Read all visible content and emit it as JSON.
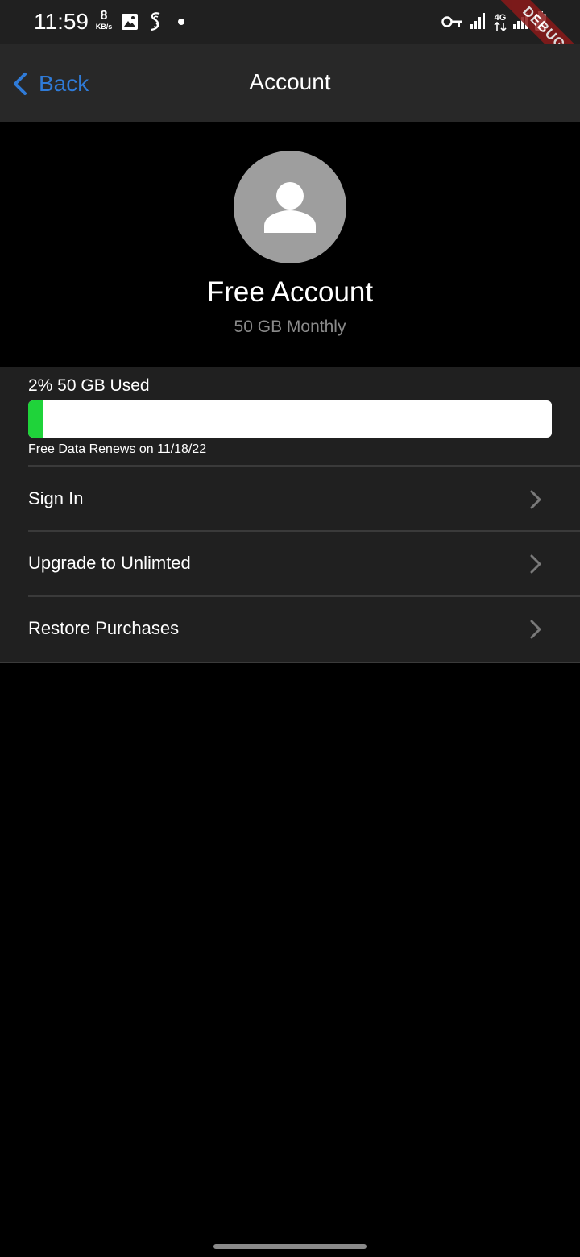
{
  "status_bar": {
    "time": "11:59",
    "net_speed_value": "8",
    "net_speed_unit": "KB/s",
    "network_type": "4G",
    "debug_banner": "DEBUG"
  },
  "nav": {
    "back_label": "Back",
    "title": "Account"
  },
  "profile": {
    "name": "Free Account",
    "plan": "50 GB Monthly"
  },
  "usage": {
    "label": "2% 50 GB Used",
    "percent": 2,
    "renew_text": "Free Data Renews on 11/18/22"
  },
  "menu": [
    {
      "label": "Sign In"
    },
    {
      "label": "Upgrade to Unlimted"
    },
    {
      "label": "Restore Purchases"
    }
  ],
  "colors": {
    "accent": "#2f7bd8",
    "progress": "#1fd33a"
  }
}
